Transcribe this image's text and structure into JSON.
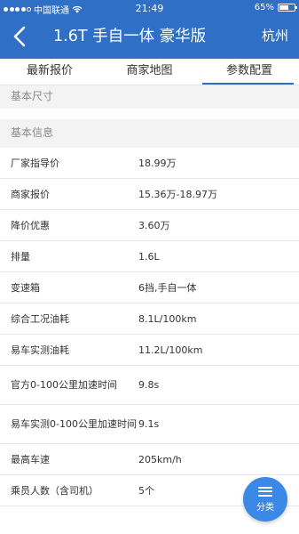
{
  "status_bar": {
    "carrier": "中国联通",
    "time": "21:49",
    "battery": "65%",
    "battery_level": 0.65
  },
  "header": {
    "title": "1.6T 手自一体 豪华版",
    "city": "杭州"
  },
  "tabs": [
    {
      "label": "最新报价",
      "active": false
    },
    {
      "label": "商家地图",
      "active": false
    },
    {
      "label": "参数配置",
      "active": true
    }
  ],
  "sections": {
    "basic_size": "基本尺寸",
    "basic_info": "基本信息"
  },
  "rows": [
    {
      "label": "厂家指导价",
      "value": "18.99万"
    },
    {
      "label": "商家报价",
      "value": "15.36万-18.97万"
    },
    {
      "label": "降价优惠",
      "value": "3.60万"
    },
    {
      "label": "排量",
      "value": "1.6L"
    },
    {
      "label": "变速箱",
      "value": "6挡,手自一体"
    },
    {
      "label": "综合工况油耗",
      "value": "8.1L/100km"
    },
    {
      "label": "易车实测油耗",
      "value": "11.2L/100km"
    },
    {
      "label": "官方0-100公里加速时间",
      "value": "9.8s"
    },
    {
      "label": "易车实测0-100公里加速时间",
      "value": "9.1s"
    },
    {
      "label": "最高车速",
      "value": "205km/h"
    },
    {
      "label": "乘员人数（含司机）",
      "value": "5个"
    }
  ],
  "fab": {
    "label": "分类",
    "icon": "menu-icon"
  },
  "colors": {
    "header_bg": "#2f6fc6",
    "fab_bg": "#3b88e6",
    "section_bg": "#f3f3f3"
  }
}
